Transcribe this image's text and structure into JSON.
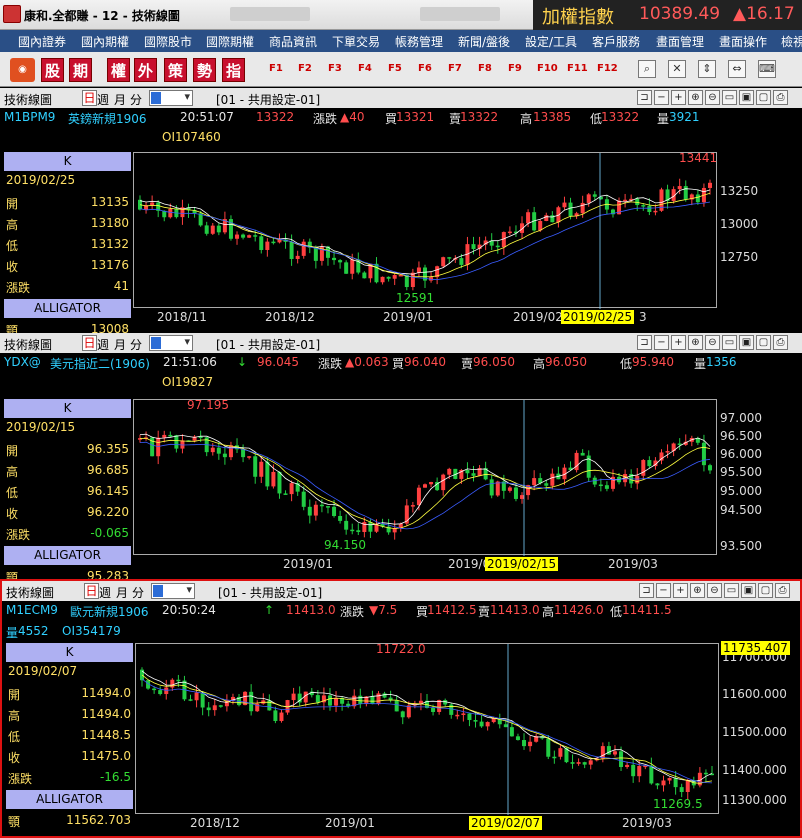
{
  "window": {
    "title": "康和.全都賺 - 12 - 技術線圖"
  },
  "index": {
    "label": "加權指數",
    "value": "10389.49",
    "change": "▲16.17"
  },
  "menu": [
    "國內證券",
    "國內期權",
    "國際股市",
    "國際期權",
    "商品資訊",
    "下單交易",
    "帳務管理",
    "新聞/盤後",
    "設定/工具",
    "客戶服務",
    "畫面管理",
    "畫面操作",
    "檢視"
  ],
  "toolbar": {
    "keys": [
      "股",
      "期",
      "權",
      "外",
      "策",
      "勢",
      "指"
    ],
    "fkeys": [
      "F1",
      "F2",
      "F3",
      "F4",
      "F5",
      "F6",
      "F7",
      "F8",
      "F9",
      "F10",
      "F11",
      "F12"
    ]
  },
  "panel_common": {
    "title": "技術線圖",
    "day": "日",
    "week": "週",
    "month": "月",
    "minute": "分",
    "config": "[01 - 共用設定-01]"
  },
  "panels": [
    {
      "symbol": "M1BPM9",
      "name": "英鎊新規1906",
      "time": "20:51:07",
      "arrow": "",
      "price": "13322",
      "chg_label": "漲跌",
      "chg": "▲40",
      "bid_label": "買",
      "bid": "13321",
      "ask_label": "賣",
      "ask": "13322",
      "high_label": "高",
      "high": "13385",
      "low_label": "低",
      "low": "13322",
      "vol_label": "量",
      "vol": "3921",
      "oi": "OI107460",
      "side": {
        "k": "K",
        "date": "2019/02/25",
        "open": "13135",
        "high": "13180",
        "low": "13132",
        "close": "13176",
        "chg": "41",
        "labels": [
          "開",
          "高",
          "低",
          "收",
          "漲跌"
        ],
        "alligator": "ALLIGATOR",
        "extra_label": "顎",
        "extra": "13008"
      },
      "yticks": [
        "13250",
        "13000",
        "12750"
      ],
      "xticks": [
        "2018/11",
        "2018/12",
        "2019/01",
        "2019/02"
      ],
      "cursor_date": "2019/02/25",
      "cursor_tail": "3",
      "max_label": "13441",
      "min_label": "12591"
    },
    {
      "symbol": "YDX@",
      "name": "美元指近二(1906)",
      "time": "21:51:06",
      "arrow": "↓",
      "price": "96.045",
      "chg_label": "漲跌",
      "chg": "▲0.063",
      "bid_label": "買",
      "bid": "96.040",
      "ask_label": "賣",
      "ask": "96.050",
      "high_label": "高",
      "high": "96.050",
      "low_label": "低",
      "low": "95.940",
      "vol_label": "量",
      "vol": "1356",
      "oi": "OI19827",
      "side": {
        "k": "K",
        "date": "2019/02/15",
        "open": "96.355",
        "high": "96.685",
        "low": "96.145",
        "close": "96.220",
        "chg": "-0.065",
        "labels": [
          "開",
          "高",
          "低",
          "收",
          "漲跌"
        ],
        "alligator": "ALLIGATOR",
        "extra_label": "顎",
        "extra": "95.283"
      },
      "yticks": [
        "97.000",
        "96.500",
        "96.000",
        "95.500",
        "95.000",
        "94.500",
        "93.500"
      ],
      "xticks": [
        "2019/01",
        "2019/02",
        "2019/03"
      ],
      "cursor_date": "2019/02/15",
      "cursor_tail": "",
      "max_label": "97.195",
      "min_label": "94.150"
    },
    {
      "symbol": "M1ECM9",
      "name": "歐元新規1906",
      "time": "20:50:24",
      "arrow": "↑",
      "price": "11413.0",
      "chg_label": "漲跌",
      "chg": "▼7.5",
      "bid_label": "買",
      "bid": "11412.5",
      "ask_label": "賣",
      "ask": "11413.0",
      "high_label": "高",
      "high": "11426.0",
      "low_label": "低",
      "low": "11411.5",
      "vol_label": "量",
      "vol": "4552",
      "oi": "OI354179",
      "side": {
        "k": "K",
        "date": "2019/02/07",
        "open": "11494.0",
        "high": "11494.0",
        "low": "11448.5",
        "close": "11475.0",
        "chg": "-16.5",
        "labels": [
          "開",
          "高",
          "低",
          "收",
          "漲跌"
        ],
        "alligator": "ALLIGATOR",
        "extra_label": "顎",
        "extra": "11562.703"
      },
      "yticks": [
        "11700.000",
        "11600.000",
        "11500.000",
        "11400.000",
        "11300.000"
      ],
      "xticks": [
        "2018/12",
        "2019/01",
        "201",
        "2019/03"
      ],
      "cursor_date": "2019/02/07",
      "cursor_tail": "",
      "max_label": "11722.0",
      "min_label": "11269.5",
      "last_tag": "11735.407"
    }
  ]
}
